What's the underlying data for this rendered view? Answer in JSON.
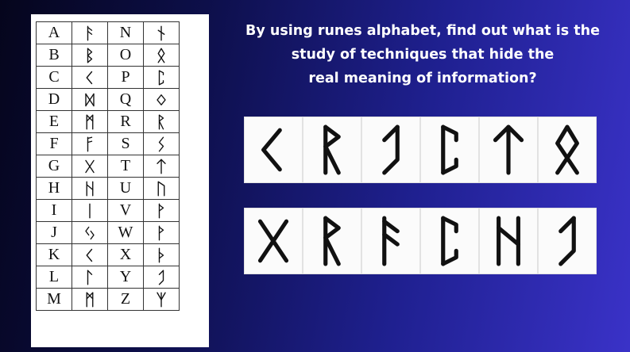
{
  "question": {
    "line1": "By using runes alphabet,  find out what is the",
    "line2": "study of techniques that hide the",
    "line3": "real meaning of information?"
  },
  "rune_table": {
    "rows": [
      {
        "l1": "A",
        "r1": "ansuz-a",
        "l2": "N",
        "r2": "naudiz-n"
      },
      {
        "l1": "B",
        "r1": "berkanan-b",
        "l2": "O",
        "r2": "othala-o"
      },
      {
        "l1": "C",
        "r1": "kaunan-c",
        "l2": "P",
        "r2": "perth-p"
      },
      {
        "l1": "D",
        "r1": "dagaz-d",
        "l2": "Q",
        "r2": "ingwaz-q"
      },
      {
        "l1": "E",
        "r1": "mannaz-e",
        "l2": "R",
        "r2": "raidho-r"
      },
      {
        "l1": "F",
        "r1": "oss-f",
        "l2": "S",
        "r2": "sowilo-s"
      },
      {
        "l1": "G",
        "r1": "gebo-g",
        "l2": "T",
        "r2": "tiwaz-t"
      },
      {
        "l1": "H",
        "r1": "hagalaz-h",
        "l2": "U",
        "r2": "uruz-u"
      },
      {
        "l1": "I",
        "r1": "isa-i",
        "l2": "V",
        "r2": "wunjo-v"
      },
      {
        "l1": "J",
        "r1": "jera-j",
        "l2": "W",
        "r2": "wunjo-w"
      },
      {
        "l1": "K",
        "r1": "kaunan-k",
        "l2": "X",
        "r2": "thurisaz-x"
      },
      {
        "l1": "L",
        "r1": "laguz-l",
        "l2": "Y",
        "r2": "eihwaz-y"
      },
      {
        "l1": "M",
        "r1": "mannaz-m",
        "l2": "Z",
        "r2": "algiz-z"
      }
    ]
  },
  "puzzle": {
    "word1": [
      "kaunan-c",
      "raidho-r",
      "eihwaz-y",
      "perth-p",
      "tiwaz-t",
      "othala-o"
    ],
    "word2": [
      "gebo-g",
      "raidho-r",
      "ansuz-a",
      "perth-p",
      "hagalaz-h",
      "eihwaz-y"
    ]
  }
}
